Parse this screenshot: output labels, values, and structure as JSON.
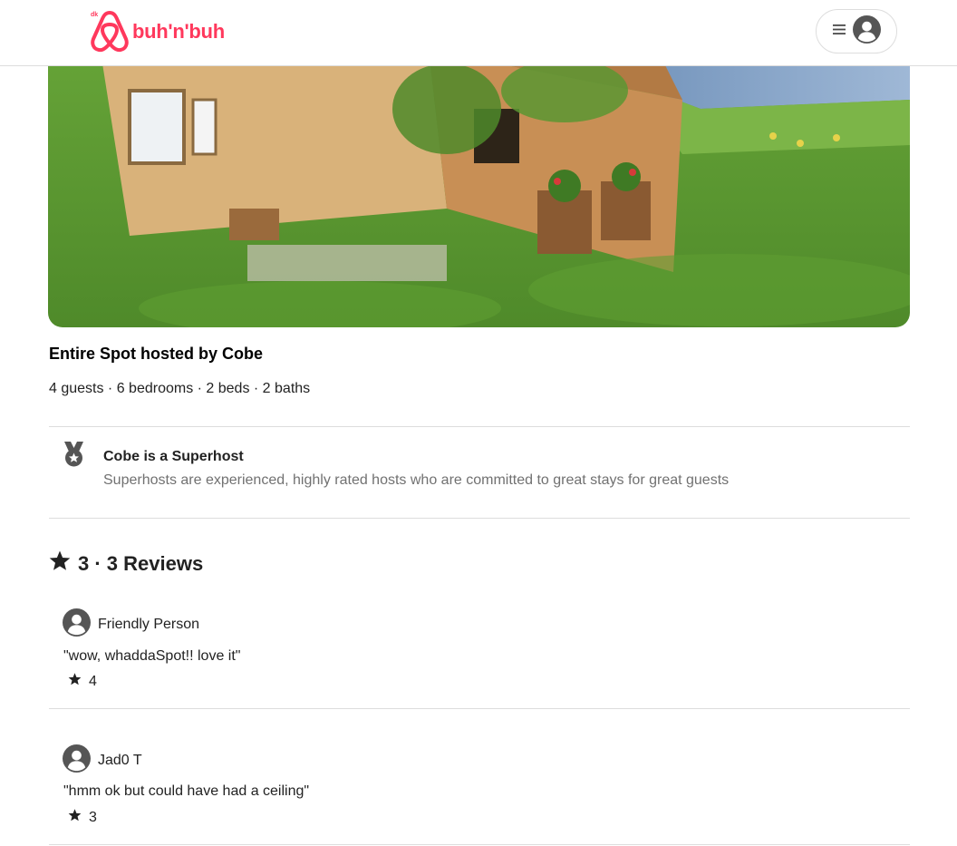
{
  "header": {
    "logo_small": "dk",
    "logo_text": "buh'n'buh"
  },
  "listing": {
    "title": "Entire Spot hosted by Cobe",
    "specs": "4 guests · 6 bedrooms · 2 beds · 2 baths",
    "superhost": {
      "title": "Cobe is a Superhost",
      "description": "Superhosts are experienced, highly rated hosts who are committed to great stays for great guests"
    }
  },
  "reviews": {
    "heading": "3 · 3 Reviews",
    "items": [
      {
        "author": "Friendly Person",
        "text": "\"wow, whaddaSpot!! love it\"",
        "rating": "4"
      },
      {
        "author": "Jad0 T",
        "text": "\"hmm ok but could have had a ceiling\"",
        "rating": "3"
      }
    ]
  },
  "colors": {
    "brand": "#ff385c",
    "text": "#222222",
    "muted": "#717171",
    "divider": "#dddddd"
  },
  "icons": [
    "hamburger-menu-icon",
    "user-avatar-icon",
    "medal-icon",
    "star-icon"
  ]
}
